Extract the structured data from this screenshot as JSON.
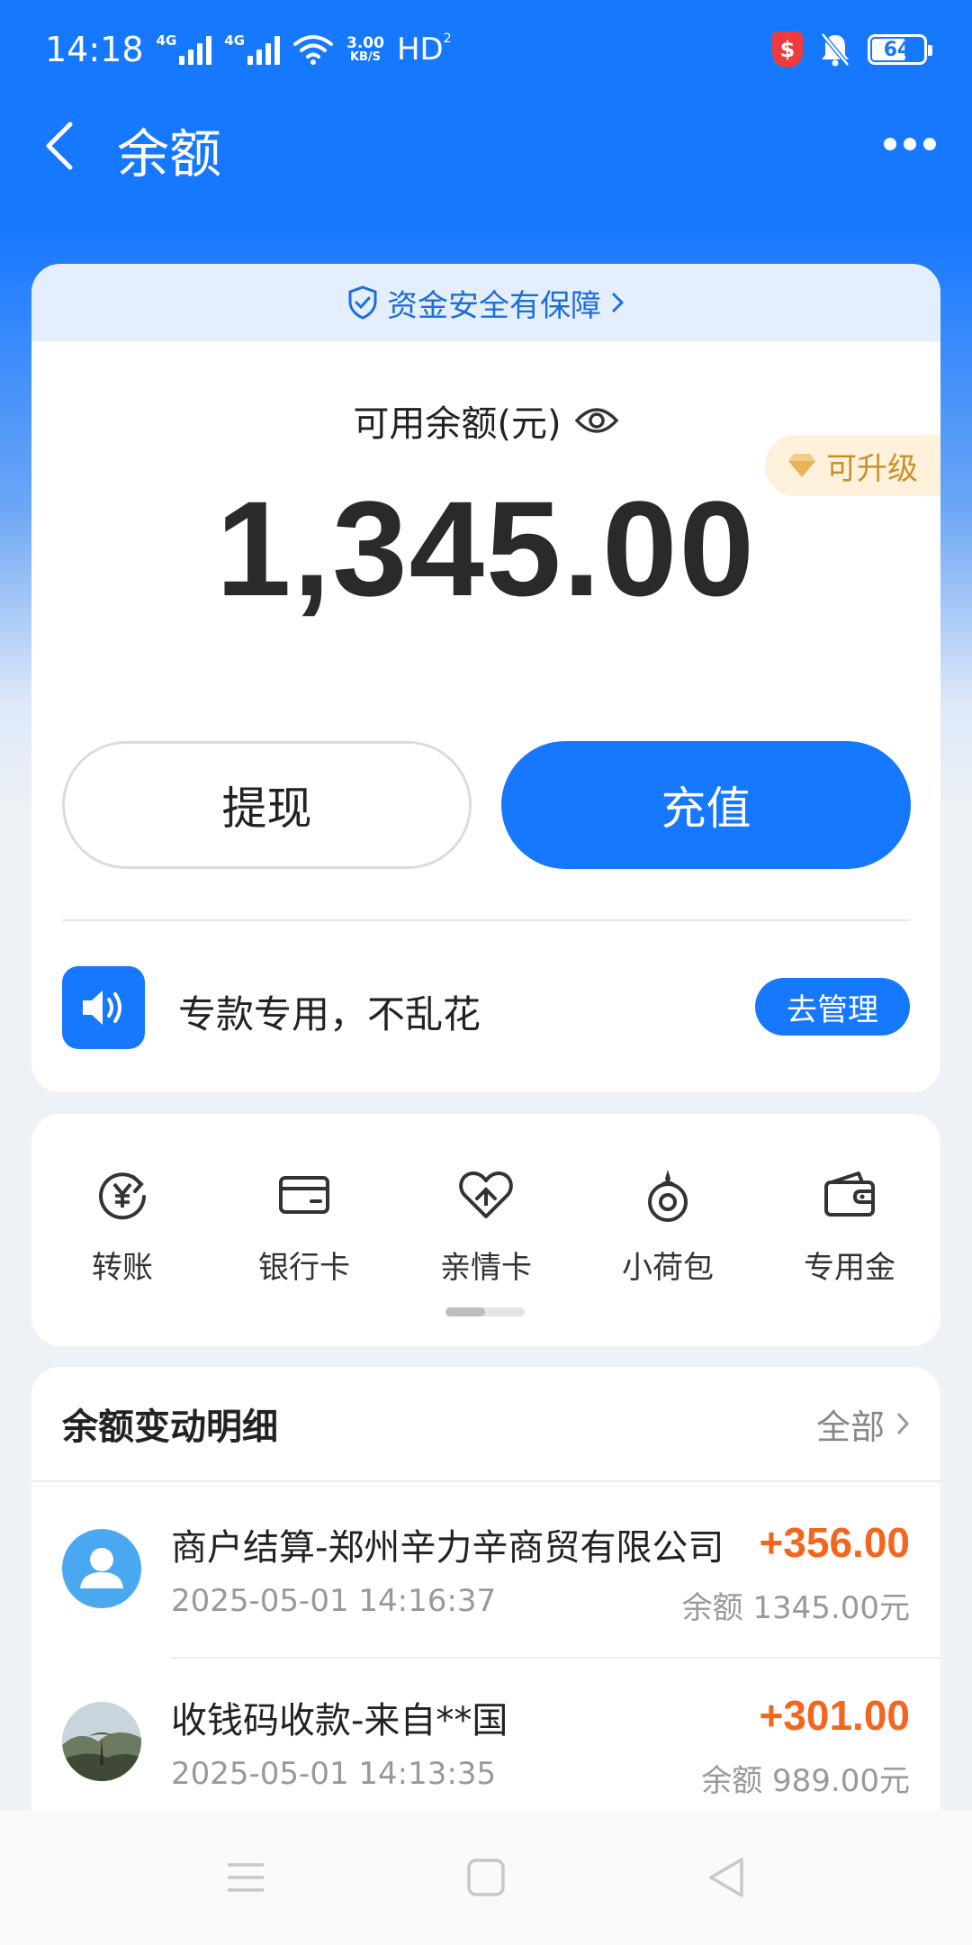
{
  "status_bar": {
    "time": "14:18",
    "network1": "4G",
    "network2": "4G",
    "speed_top": "3.00",
    "speed_bottom": "KB/S",
    "hd": "HD",
    "hd_sub": "2",
    "security_badge": "$",
    "battery": "64"
  },
  "header": {
    "title": "余额"
  },
  "balance_card": {
    "safety_text": "资金安全有保障",
    "label": "可用余额(元)",
    "amount": "1,345.00",
    "upgrade_badge": "可升级",
    "withdraw_label": "提现",
    "topup_label": "充值",
    "notice_text": "专款专用，不乱花",
    "manage_label": "去管理"
  },
  "shortcuts": [
    {
      "label": "转账",
      "icon": "transfer-yuan-icon"
    },
    {
      "label": "银行卡",
      "icon": "bank-card-icon"
    },
    {
      "label": "亲情卡",
      "icon": "family-card-icon"
    },
    {
      "label": "小荷包",
      "icon": "purse-icon"
    },
    {
      "label": "专用金",
      "icon": "wallet-icon"
    }
  ],
  "details": {
    "title": "余额变动明细",
    "filter": "全部",
    "transactions": [
      {
        "name": "商户结算-郑州辛力辛商贸有限公司",
        "time": "2025-05-01 14:16:37",
        "amount": "+356.00",
        "balance": "余额 1345.00元"
      },
      {
        "name": "收钱码收款-来自**国",
        "time": "2025-05-01 14:13:35",
        "amount": "+301.00",
        "balance": "余额 989.00元"
      }
    ]
  },
  "colors": {
    "primary": "#1677ff",
    "amount_positive": "#f3661e",
    "upgrade_gold": "#c8902d"
  }
}
